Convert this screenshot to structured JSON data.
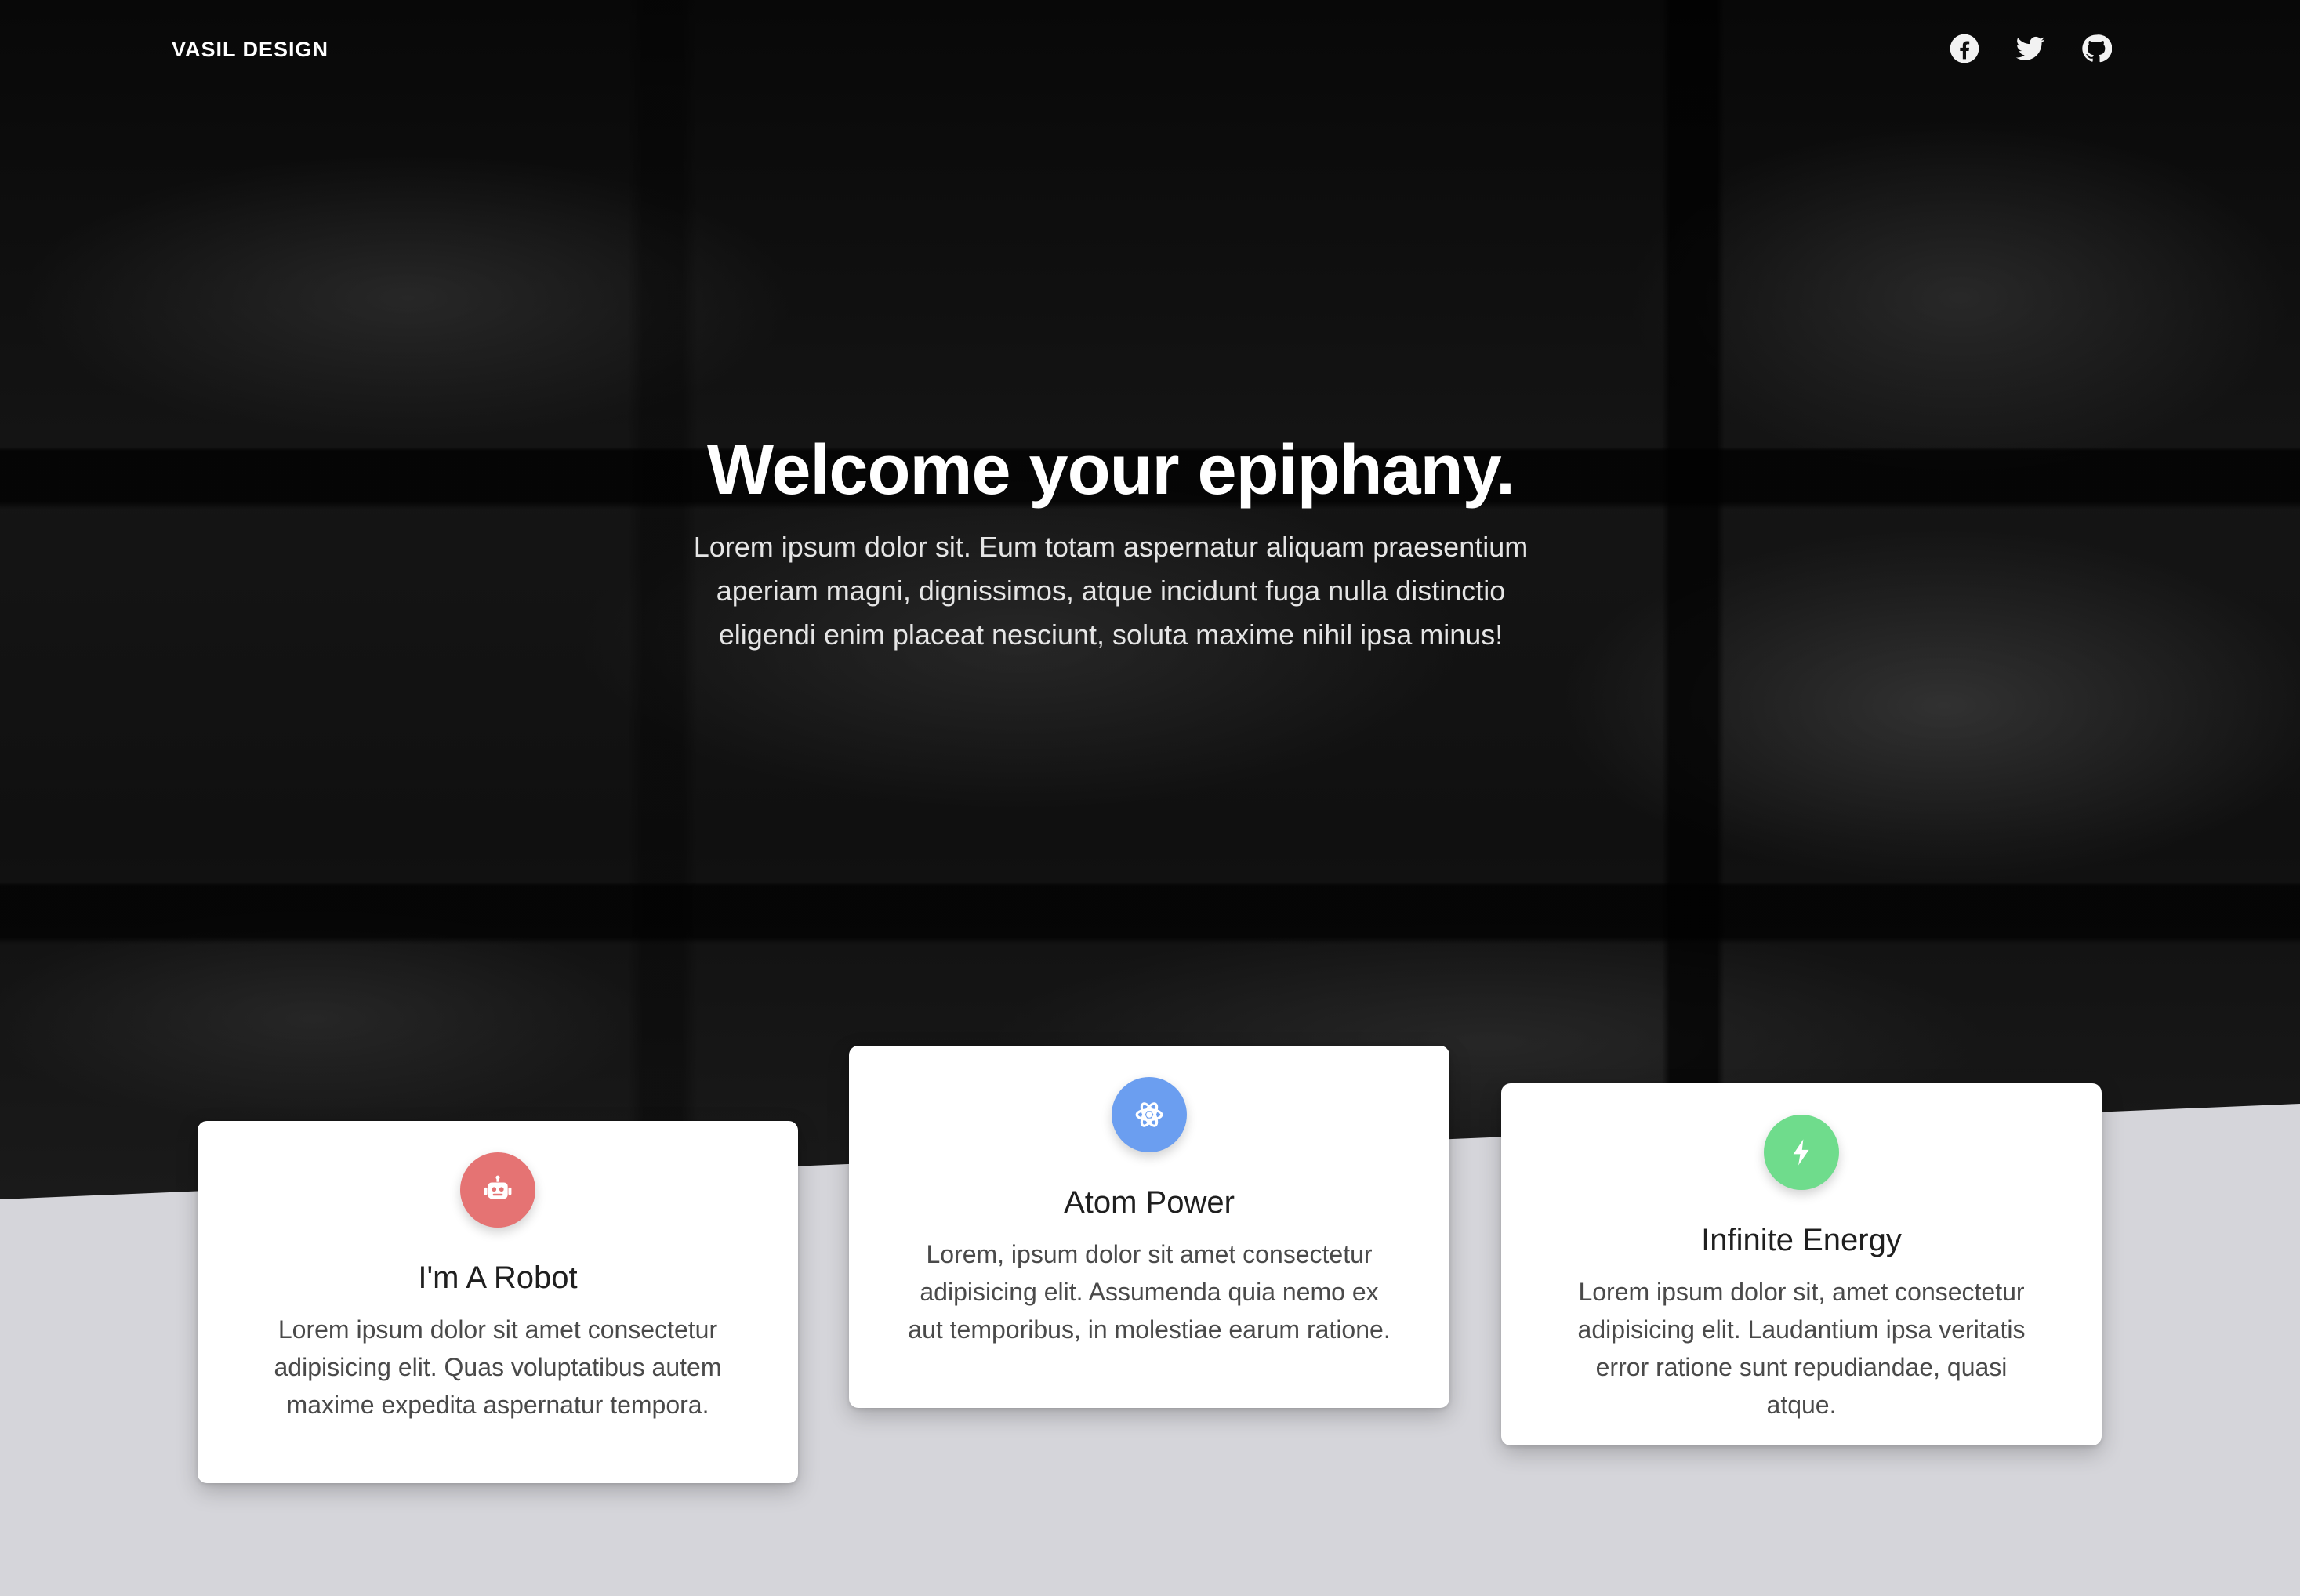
{
  "nav": {
    "brand": "VASIL DESIGN",
    "social": [
      {
        "icon": "facebook-icon"
      },
      {
        "icon": "twitter-icon"
      },
      {
        "icon": "github-icon"
      }
    ]
  },
  "hero": {
    "title": "Welcome your epiphany.",
    "text": "Lorem ipsum dolor sit. Eum totam aspernatur aliquam praesentium aperiam magni, dignissimos, atque incidunt fuga nulla distinctio eligendi enim placeat nesciunt, soluta maxime nihil ipsa minus!"
  },
  "cards": [
    {
      "icon": "robot-icon",
      "icon_color": "#e57373",
      "title": "I'm A Robot",
      "text": "Lorem ipsum dolor sit amet consectetur adipisicing elit. Quas voluptatibus autem maxime expedita aspernatur tempora."
    },
    {
      "icon": "atom-icon",
      "icon_color": "#6b9ef0",
      "title": "Atom Power",
      "text": "Lorem, ipsum dolor sit amet consectetur adipisicing elit. Assumenda quia nemo ex aut temporibus, in molestiae earum ratione."
    },
    {
      "icon": "lightning-bolt-icon",
      "icon_color": "#6fdc8c",
      "title": "Infinite Energy",
      "text": "Lorem ipsum dolor sit, amet consectetur adipisicing elit. Laudantium ipsa veritatis error ratione sunt repudiandae, quasi atque."
    }
  ],
  "colors": {
    "page_background": "#d5d5da",
    "hero_background": "#111111"
  }
}
